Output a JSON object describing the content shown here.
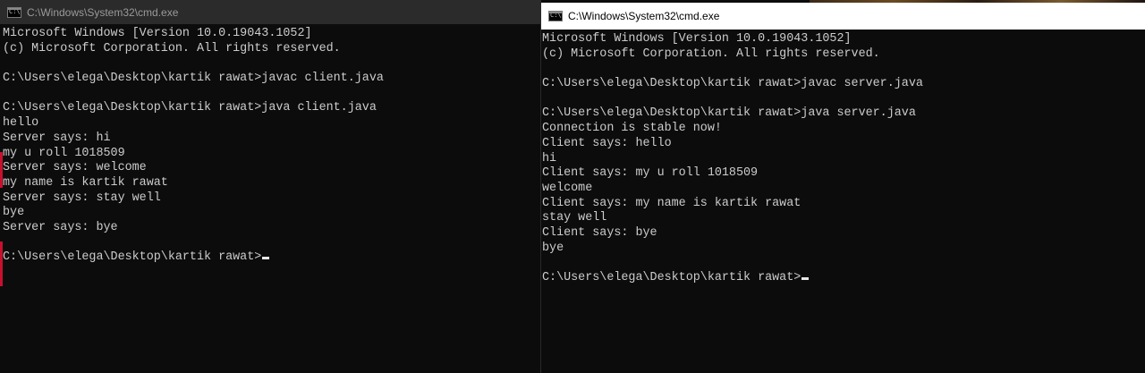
{
  "left_window": {
    "title": "C:\\Windows\\System32\\cmd.exe",
    "lines": [
      "Microsoft Windows [Version 10.0.19043.1052]",
      "(c) Microsoft Corporation. All rights reserved.",
      "",
      "C:\\Users\\elega\\Desktop\\kartik rawat>javac client.java",
      "",
      "C:\\Users\\elega\\Desktop\\kartik rawat>java client.java",
      "hello",
      "Server says: hi",
      "my u roll 1018509",
      "Server says: welcome",
      "my name is kartik rawat",
      "Server says: stay well",
      "bye",
      "Server says: bye",
      ""
    ],
    "prompt": "C:\\Users\\elega\\Desktop\\kartik rawat>"
  },
  "right_window": {
    "title": "C:\\Windows\\System32\\cmd.exe",
    "lines": [
      "Microsoft Windows [Version 10.0.19043.1052]",
      "(c) Microsoft Corporation. All rights reserved.",
      "",
      "C:\\Users\\elega\\Desktop\\kartik rawat>javac server.java",
      "",
      "C:\\Users\\elega\\Desktop\\kartik rawat>java server.java",
      "Connection is stable now!",
      "Client says: hello",
      "hi",
      "Client says: my u roll 1018509",
      "welcome",
      "Client says: my name is kartik rawat",
      "stay well",
      "Client says: bye",
      "bye",
      ""
    ],
    "prompt": "C:\\Users\\elega\\Desktop\\kartik rawat>"
  },
  "colors": {
    "terminal_bg": "#0c0c0c",
    "terminal_fg": "#cccccc",
    "inactive_titlebar": "#2b2b2b",
    "active_titlebar": "#ffffff"
  },
  "icons": {
    "window_icon": "cmd-icon"
  }
}
